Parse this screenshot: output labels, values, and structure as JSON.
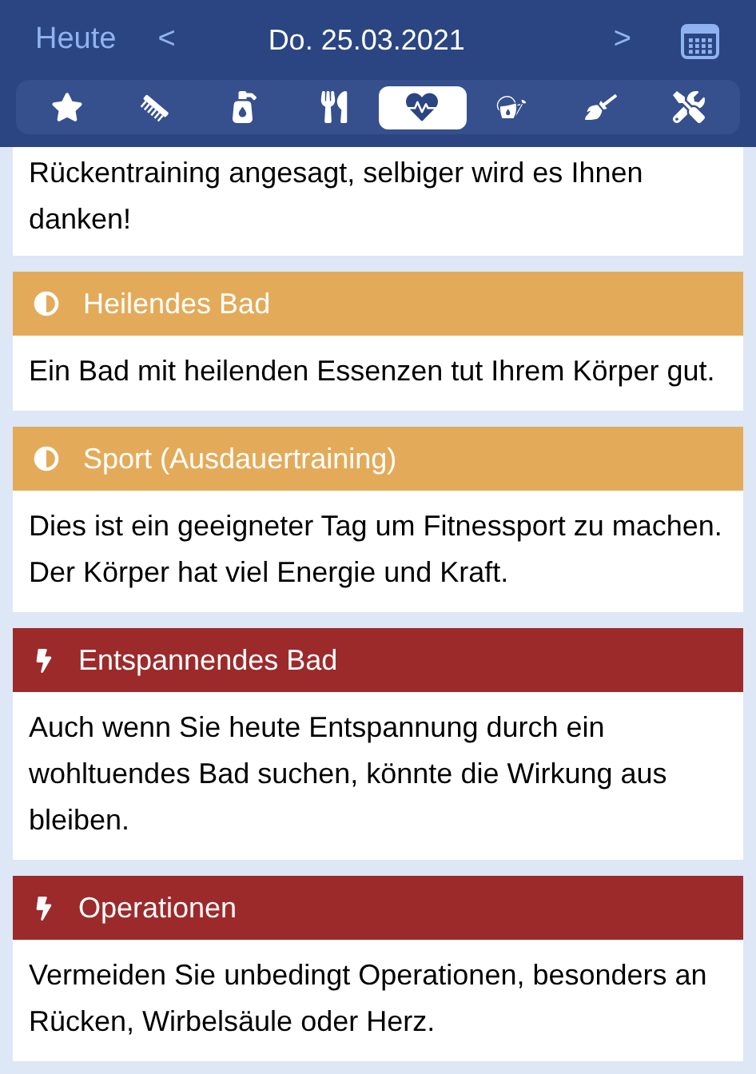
{
  "header": {
    "today": "Heute",
    "prev": "<",
    "date": "Do. 25.03.2021",
    "next": ">"
  },
  "tabs": [
    {
      "selected": false
    },
    {
      "selected": false
    },
    {
      "selected": false
    },
    {
      "selected": false
    },
    {
      "selected": true
    },
    {
      "selected": false
    },
    {
      "selected": false
    },
    {
      "selected": false
    }
  ],
  "intro": {
    "text": "Rückentraining angesagt, selbiger wird es Ihnen danken!"
  },
  "entries": [
    {
      "kind": "good",
      "title": "Heilendes Bad",
      "text": "Ein Bad mit heilenden Essenzen tut Ihrem Körper gut."
    },
    {
      "kind": "good",
      "title": "Sport (Ausdauertraining)",
      "text": "Dies ist ein geeigneter Tag um Fitnessport zu machen. Der Körper hat viel Energie und Kraft."
    },
    {
      "kind": "bad",
      "title": "Entspannendes Bad",
      "text": "Auch wenn Sie heute Entspannung durch ein wohltuendes Bad suchen, könnte die Wirkung aus bleiben."
    },
    {
      "kind": "bad",
      "title": "Operationen",
      "text": "Vermeiden Sie unbedingt Operationen, besonders an Rücken, Wirbelsäule oder Herz."
    }
  ]
}
